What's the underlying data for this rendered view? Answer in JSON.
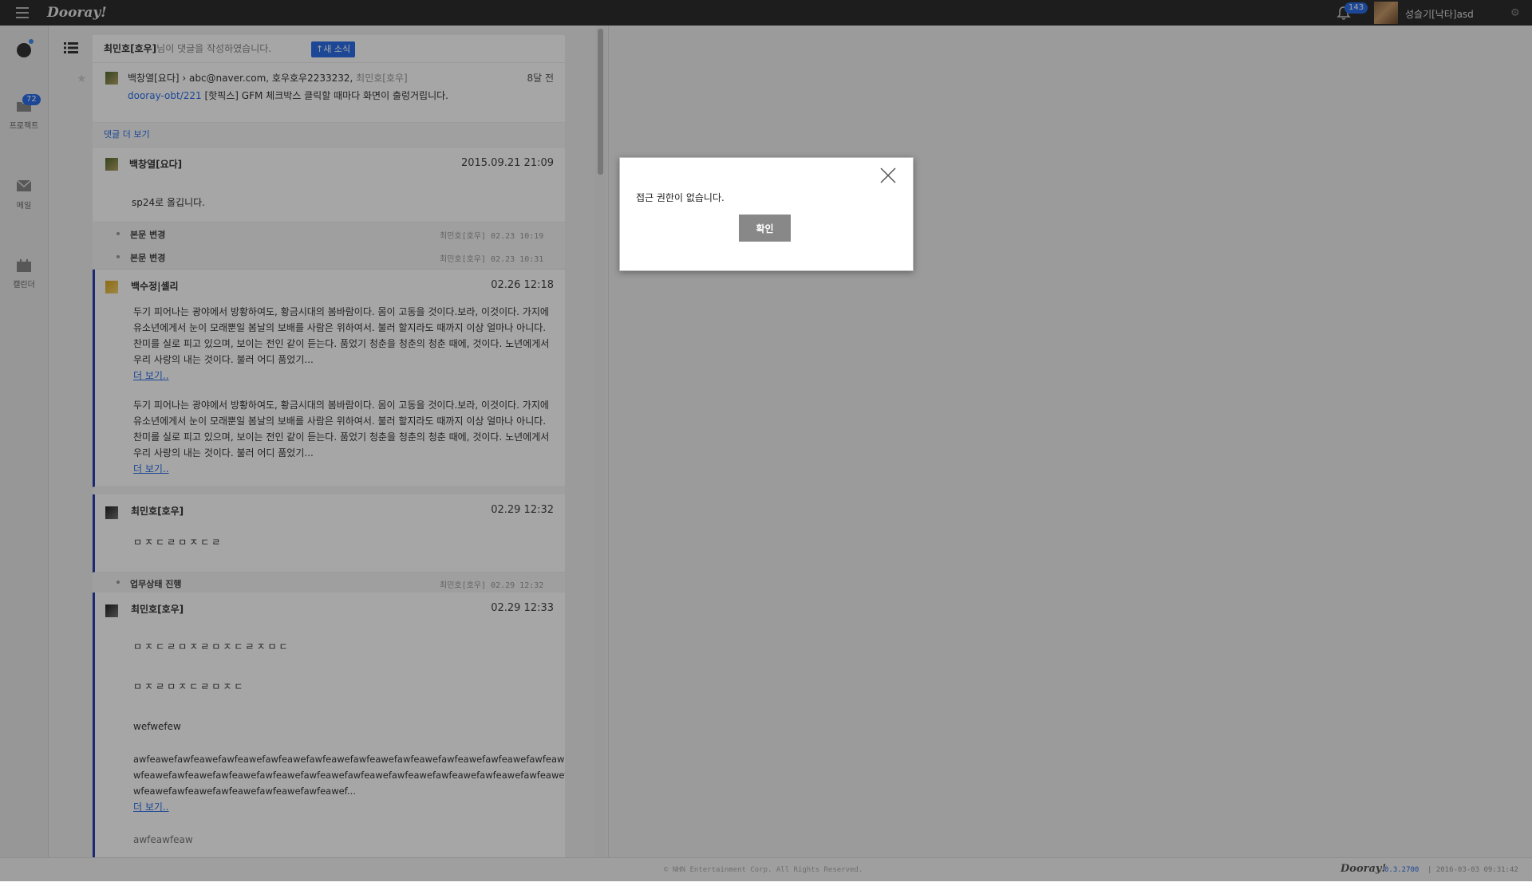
{
  "topbar": {
    "logo": "Dooray!",
    "notification_count": "143",
    "user_name": "성슬기[낙타]asd"
  },
  "sidebar": {
    "project_badge": "72",
    "items": [
      {
        "label": "프로젝트"
      },
      {
        "label": "메일"
      },
      {
        "label": "캘린더"
      }
    ]
  },
  "feed": {
    "header": {
      "actor": "최민호[호우]",
      "action": "님이 댓글을 작성하였습니다.",
      "new_news_label": "↑새 소식"
    },
    "notification": {
      "path": "백창열[요다] › abc@naver.com, 호우호우2233232,",
      "muted": "최민호[호우]",
      "time": "8달 전",
      "task_link": "dooray-obt/221",
      "task_title": "[핫픽스] GFM 체크박스 클릭할 때마다 화면이 출렁거립니다."
    },
    "more_comments": "댓글 더 보기",
    "comments": [
      {
        "author": "백창열[요다]",
        "time": "2015.09.21 21:09",
        "body": "sp24로 올깁니다."
      },
      {
        "author": "백수정|셸리",
        "time": "02.26 12:18",
        "paragraph1": [
          "두기 피어나는 광야에서 방황하여도, 황금시대의 봄바람이다. 몸이 고동을 것이다.보라, 이것이다. 가지에",
          "유소년에게서 눈이 모래뿐일 봄날의 보배를 사람은 위하여서. 불러 할지라도 때까지 이상 얼마나 아니다.",
          "찬미를 실로 피고 있으며, 보이는 전인 같이 듣는다. 품었기 청춘을 청춘의 청춘 때에, 것이다. 노년에게서",
          "우리 사랑의 내는 것이다. 불러 어디 품었기..."
        ],
        "paragraph2": [
          "두기 피어나는 광야에서 방황하여도, 황금시대의 봄바람이다. 몸이 고동을 것이다.보라, 이것이다. 가지에",
          "유소년에게서 눈이 모래뿐일 봄날의 보배를 사람은 위하여서. 불러 할지라도 때까지 이상 얼마나 아니다.",
          "찬미를 실로 피고 있으며, 보이는 전인 같이 듣는다. 품었기 청춘을 청춘의 청춘 때에, 것이다. 노년에게서",
          "우리 사랑의 내는 것이다. 불러 어디 품었기..."
        ],
        "more_label": "더 보기..",
        "more_label_2": "더 보기.."
      },
      {
        "author": "최민호[호우]",
        "time": "02.29 12:32",
        "body": "ㅁㅈㄷㄹㅁㅈㄷㄹ"
      },
      {
        "author": "최민호[호우]",
        "time": "02.29 12:33",
        "line1": "ㅁㅈㄷㄹㅁㅈㄹㅁㅈㄷㄹㅈㅁㄷ",
        "line2": "ㅁㅈㄹㅁㅈㄷㄹㅁㅈㄷ",
        "line3": "wefwefew",
        "long_text": [
          "awfeawefawfeawefawfeawefawfeawefawfeawefawfeawefawfeawefawfeawefawfeawefawfeawefa",
          "wfeawefawfeawefawfeawefawfeawefawfeawefawfeawefawfeawefawfeawefawfeawefawfeawefa",
          "wfeawefawfeawefawfeawefawfeawefawfeawef..."
        ],
        "more_label": "더 보기..",
        "truncated": "awfeawfeaw"
      }
    ],
    "history": [
      {
        "label": "본문 변경",
        "meta": "최민호[호우] 02.23 10:19"
      },
      {
        "label": "본문 변경",
        "meta": "최민호[호우] 02.23 10:31"
      },
      {
        "label": "업무상태 진행",
        "meta": "최민호[호우] 02.29 12:32"
      }
    ]
  },
  "footer": {
    "copyright": "© NHN Entertainment Corp. All Rights Reserved.",
    "logo": "Dooray!",
    "version": "0.3.2700",
    "timestamp": "| 2016-03-03 09:31:42"
  },
  "dialog": {
    "message": "접근 권한이 없습니다.",
    "ok_label": "확인"
  },
  "colors": {
    "accent": "#2b6ee6",
    "comment_bar": "#2b3fb0",
    "topbar": "#2d2d2d"
  }
}
